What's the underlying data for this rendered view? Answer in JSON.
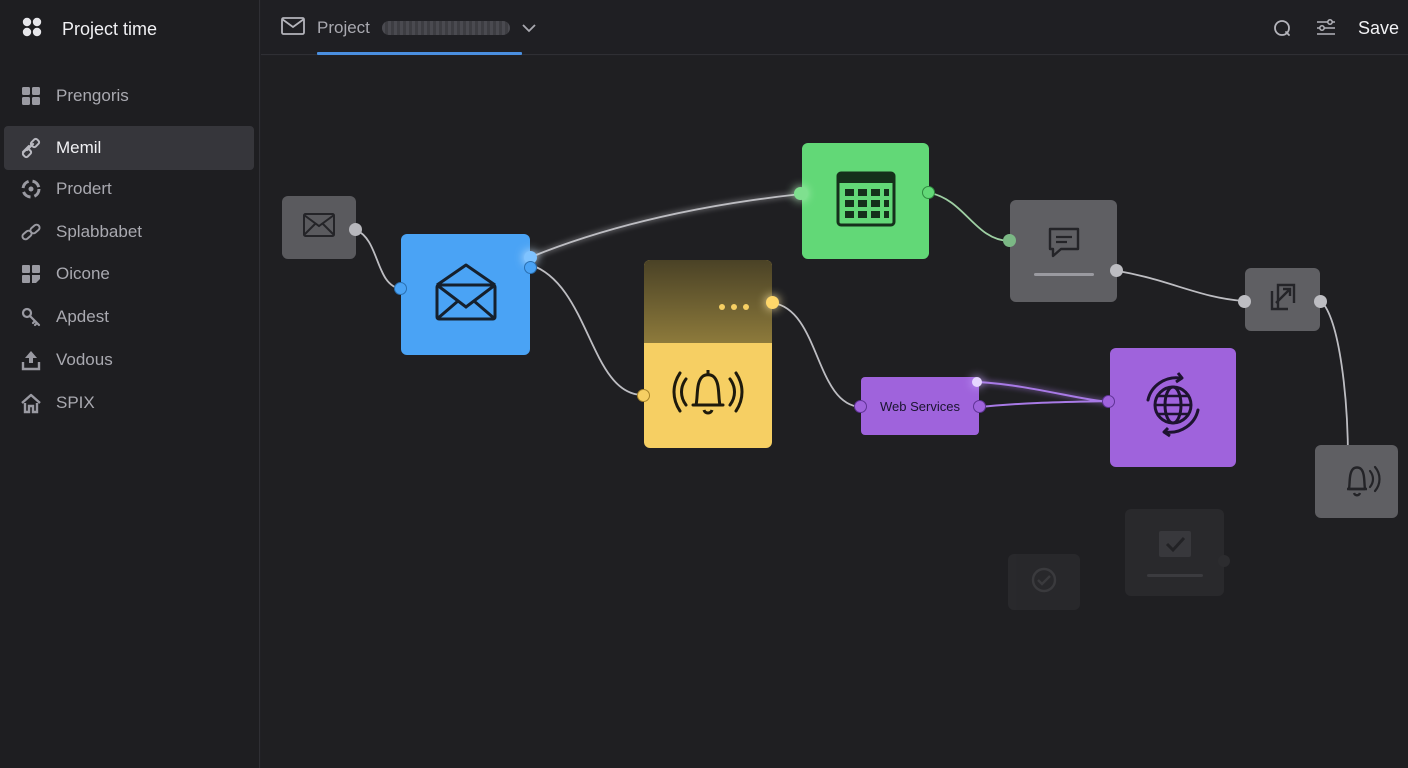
{
  "app": {
    "title": "Project time"
  },
  "sidebar": {
    "items": [
      {
        "label": "Prengoris",
        "icon": "grid-icon",
        "active": false
      },
      {
        "label": "Memil",
        "icon": "link-icon",
        "active": true
      },
      {
        "label": "Prodert",
        "icon": "cycle-icon",
        "active": false
      },
      {
        "label": "Splabbabet",
        "icon": "chain-icon",
        "active": false
      },
      {
        "label": "Oicone",
        "icon": "tiles-icon",
        "active": false
      },
      {
        "label": "Apdest",
        "icon": "key-icon",
        "active": false
      },
      {
        "label": "Vodous",
        "icon": "upload-icon",
        "active": false
      },
      {
        "label": "SPIX",
        "icon": "house-icon",
        "active": false
      }
    ]
  },
  "header": {
    "project_label": "Project",
    "save_label": "Save"
  },
  "canvas": {
    "chip_label": "Web Services"
  },
  "colors": {
    "blue": "#4aa3f5",
    "green": "#62d877",
    "yellow": "#f6cf63",
    "purple": "#9f63dc",
    "gray": "#5f5f63",
    "accent": "#4a8fe0"
  }
}
